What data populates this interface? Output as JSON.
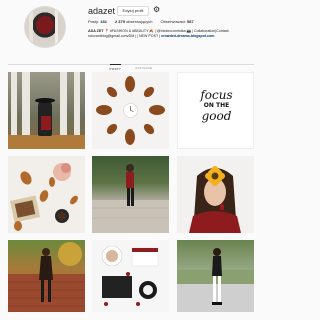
{
  "profile": {
    "username": "adazet",
    "edit_button": "Edytuj profil",
    "stats": {
      "posts_label": "Posty:",
      "posts_value": "181",
      "followers_value": "2 379",
      "followers_label": "obserwujących",
      "following_label": "Obserwowani:",
      "following_value": "587"
    },
    "bio": {
      "name": "ADA ZET",
      "line1_rest": " 📍 #FASHION & #BEAUTY 🍂 | @fotolovcomfotka 📷 | Collaboration|Contact:",
      "line2": "rolovantblog@gmail.com/DM | | NEW POST | ",
      "link": "crowded-dreams.blogspot.com"
    }
  },
  "tabs": [
    {
      "label": "POSTY",
      "active": true
    },
    {
      "label": "ZAPISANE",
      "active": false
    }
  ],
  "quote": {
    "line1": "focus",
    "line2": "ON THE",
    "line3": "good"
  },
  "icons": {
    "settings": "gear-icon"
  }
}
